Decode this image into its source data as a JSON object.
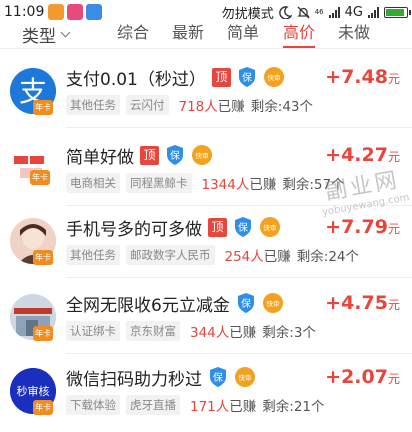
{
  "status_bar": {
    "time": "11:09",
    "mode_text": "勿扰模式",
    "network_small": "46",
    "network": "4G",
    "battery_level": 0.9
  },
  "filter": {
    "type_label": "类型"
  },
  "tabs": [
    {
      "label": "综合",
      "active": false
    },
    {
      "label": "最新",
      "active": false
    },
    {
      "label": "简单",
      "active": false
    },
    {
      "label": "高价",
      "active": true
    },
    {
      "label": "未做",
      "active": false
    }
  ],
  "badges": {
    "top": "顶",
    "bao": "保",
    "fast": "快审"
  },
  "items": [
    {
      "title": "支付0.01（秒过）",
      "top": true,
      "bao": true,
      "fast": true,
      "tags": [
        "其他任务",
        "云闪付"
      ],
      "earned_count": "718人",
      "earned_suffix": "已赚",
      "remain": "剩余:43个",
      "price": "+7.48",
      "price_unit": "元",
      "avatar_text": "支",
      "avatar_badge": "年卡"
    },
    {
      "title": "简单好做",
      "top": true,
      "bao": true,
      "fast": true,
      "tags": [
        "电商相关",
        "同程黑鲸卡"
      ],
      "earned_count": "1344人",
      "earned_suffix": "已赚",
      "remain": "剩余:57个",
      "price": "+4.27",
      "price_unit": "元",
      "avatar_badge": "年卡"
    },
    {
      "title": "手机号多的可多做",
      "top": true,
      "bao": true,
      "fast": true,
      "tags": [
        "其他任务",
        "邮政数字人民币"
      ],
      "earned_count": "254人",
      "earned_suffix": "已赚",
      "remain": "剩余:24个",
      "price": "+7.79",
      "price_unit": "元",
      "avatar_badge": "年卡"
    },
    {
      "title": "全网无限收6元立减金",
      "top": false,
      "bao": true,
      "fast": true,
      "tags": [
        "认证绑卡",
        "京东财富"
      ],
      "earned_count": "344人",
      "earned_suffix": "已赚",
      "remain": "剩余:3个",
      "price": "+4.75",
      "price_unit": "元",
      "avatar_badge": "年卡"
    },
    {
      "title": "微信扫码助力秒过",
      "top": false,
      "bao": true,
      "fast": true,
      "tags": [
        "下载体验",
        "虎牙直播"
      ],
      "earned_count": "171人",
      "earned_suffix": "已赚",
      "remain": "剩余:21个",
      "price": "+2.07",
      "price_unit": "元",
      "avatar_text": "秒审核",
      "avatar_badge": "年卡"
    }
  ],
  "watermark": {
    "cn": "副业网",
    "en": "yobuyewang.com"
  },
  "colors": {
    "accent": "#e8453c",
    "tag_bg": "#f2f2f2",
    "shield_blue": "#2f8ee5",
    "fast_orange": "#f2a21e"
  }
}
